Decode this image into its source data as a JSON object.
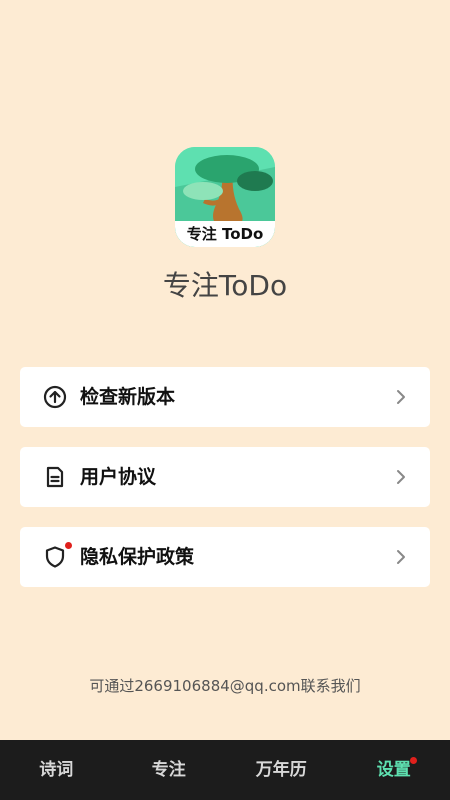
{
  "app": {
    "name": "专注ToDo",
    "icon_label": "专注 ToDo",
    "icon_bg": "#5ee0b0"
  },
  "menu": [
    {
      "label": "检查新版本",
      "icon": "arrow-up-circle-icon",
      "badge": false
    },
    {
      "label": "用户协议",
      "icon": "document-icon",
      "badge": false
    },
    {
      "label": "隐私保护政策",
      "icon": "shield-icon",
      "badge": true
    }
  ],
  "contact_text": "可通过2669106884@qq.com联系我们",
  "tabs": [
    {
      "label": "诗词",
      "active": false,
      "badge": false
    },
    {
      "label": "专注",
      "active": false,
      "badge": false
    },
    {
      "label": "万年历",
      "active": false,
      "badge": false
    },
    {
      "label": "设置",
      "active": true,
      "badge": true
    }
  ],
  "colors": {
    "background": "#fdebd3",
    "accent": "#5ee0b0",
    "badge": "#e0201c",
    "tabbar": "#1c1c1c"
  }
}
